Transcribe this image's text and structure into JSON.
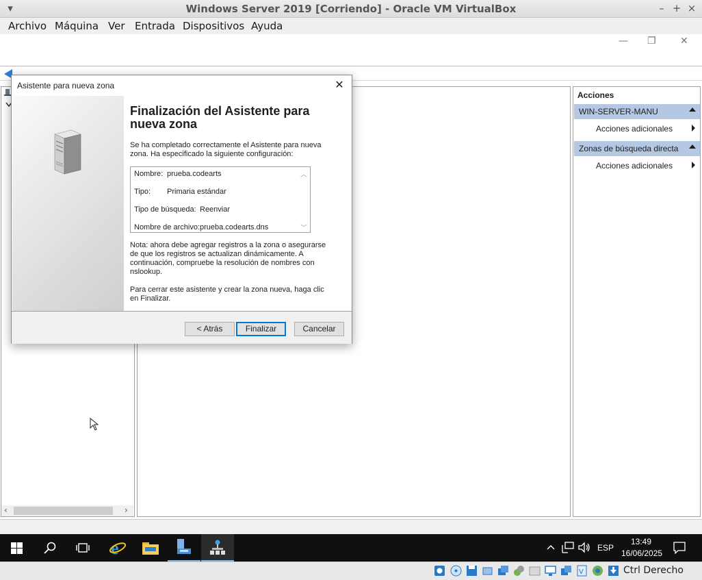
{
  "vbox": {
    "title": "Windows Server 2019 [Corriendo] - Oracle VM VirtualBox",
    "menu": [
      "Archivo",
      "Máquina",
      "Ver",
      "Entrada",
      "Dispositivos",
      "Ayuda"
    ],
    "host_key": "Ctrl Derecho"
  },
  "actions": {
    "header": "Acciones",
    "groups": [
      {
        "title": "WIN-SERVER-MANU",
        "item": "Acciones adicionales"
      },
      {
        "title": "Zonas de búsqueda directa",
        "item": "Acciones adicionales"
      }
    ]
  },
  "wizard": {
    "title": "Asistente para nueva zona",
    "heading": "Finalización del Asistente para nueva zona",
    "intro": "Se ha completado correctamente el Asistente para nueva zona. Ha especificado la siguiente configuración:",
    "summary": [
      {
        "label": "Nombre:",
        "value": "prueba.codearts"
      },
      {
        "label": "Tipo:",
        "value": "Primaria estándar"
      },
      {
        "label": "Tipo de búsqueda:",
        "value": "Reenviar"
      },
      {
        "label": "Nombre de archivo:",
        "value": "prueba.codearts.dns"
      }
    ],
    "note": "Nota: ahora debe agregar registros a la zona o asegurarse de que los registros se actualizan dinámicamente. A continuación, compruebe la resolución de nombres con nslookup.",
    "close_hint": "Para cerrar este asistente y crear la zona nueva, haga clic en Finalizar.",
    "buttons": {
      "back": "< Atrás",
      "finish": "Finalizar",
      "cancel": "Cancelar"
    }
  },
  "taskbar": {
    "language": "ESP",
    "time": "13:49",
    "date": "16/06/2025"
  }
}
